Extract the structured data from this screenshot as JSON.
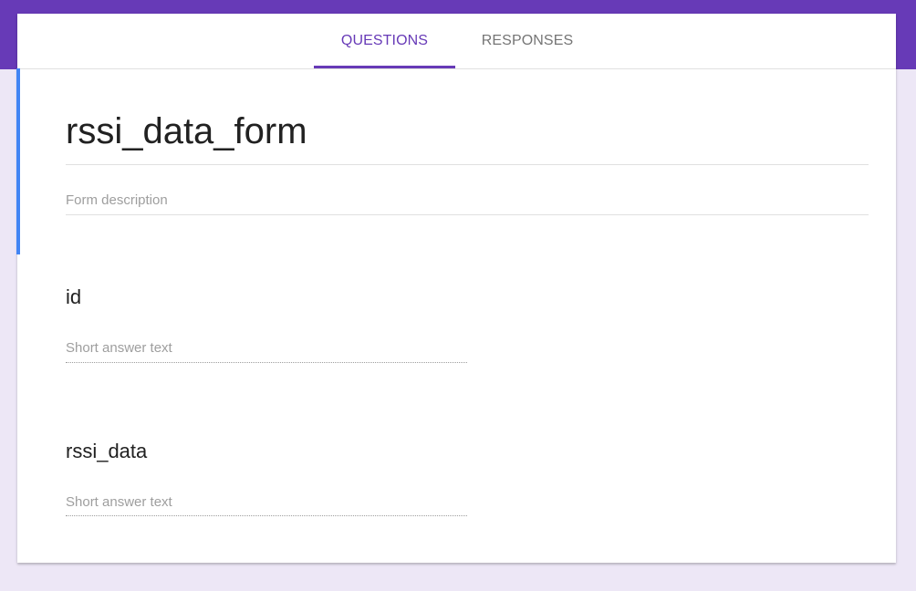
{
  "tabs": {
    "questions": "QUESTIONS",
    "responses": "RESPONSES"
  },
  "form": {
    "title": "rssi_data_form",
    "description_placeholder": "Form description"
  },
  "questions": [
    {
      "title": "id",
      "answer_placeholder": "Short answer text"
    },
    {
      "title": "rssi_data",
      "answer_placeholder": "Short answer text"
    }
  ],
  "colors": {
    "theme": "#673ab7",
    "background": "#ede7f6",
    "accent": "#4285f4"
  }
}
